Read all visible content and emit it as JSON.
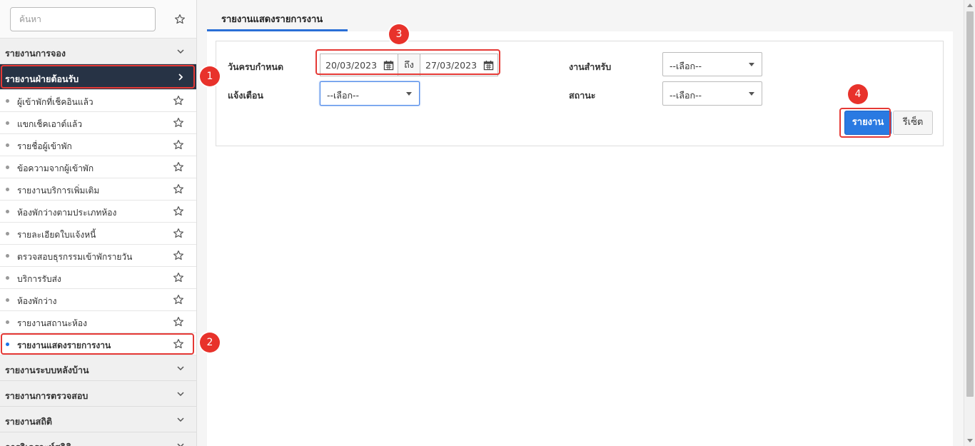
{
  "sidebar": {
    "search_placeholder": "ค้นหา",
    "groups_top": [
      {
        "label": "รายงานการจอง"
      },
      {
        "label": "รายงานฝ่ายต้อนรับ"
      }
    ],
    "items": [
      {
        "label": "ผู้เข้าพักที่เช็คอินแล้ว"
      },
      {
        "label": "แขกเช็คเอาต์แล้ว"
      },
      {
        "label": "รายชื่อผู้เข้าพัก"
      },
      {
        "label": "ข้อความจากผู้เข้าพัก"
      },
      {
        "label": "รายงานบริการเพิ่มเติม"
      },
      {
        "label": "ห้องพักว่างตามประเภทห้อง"
      },
      {
        "label": "รายละเอียดใบแจ้งหนี้"
      },
      {
        "label": "ตรวจสอบธุรกรรมเข้าพักรายวัน"
      },
      {
        "label": "บริการรับส่ง"
      },
      {
        "label": "ห้องพักว่าง"
      },
      {
        "label": "รายงานสถานะห้อง"
      },
      {
        "label": "รายงานแสดงรายการงาน"
      }
    ],
    "groups_bottom": [
      {
        "label": "รายงานระบบหลังบ้าน"
      },
      {
        "label": "รายงานการตรวจสอบ"
      },
      {
        "label": "รายงานสถิติ"
      },
      {
        "label": "การวิเคราะห์สถิติ"
      }
    ]
  },
  "main": {
    "tab_label": "รายงานแสดงรายการงาน",
    "form": {
      "due_date_label": "วันครบกำหนด",
      "date_from": "20/03/2023",
      "to_label": "ถึง",
      "date_to": "27/03/2023",
      "notify_label": "แจ้งเตือน",
      "notify_value": "--เลือก--",
      "job_for_label": "งานสำหรับ",
      "job_for_value": "--เลือก--",
      "status_label": "สถานะ",
      "status_value": "--เลือก--",
      "report_button": "รายงาน",
      "reset_button": "รีเซ็ต"
    }
  },
  "annotations": [
    "1",
    "2",
    "3",
    "4"
  ],
  "colors": {
    "accent": "#2a7ae2",
    "highlight": "#e53935",
    "active_group_bg": "#273345"
  }
}
